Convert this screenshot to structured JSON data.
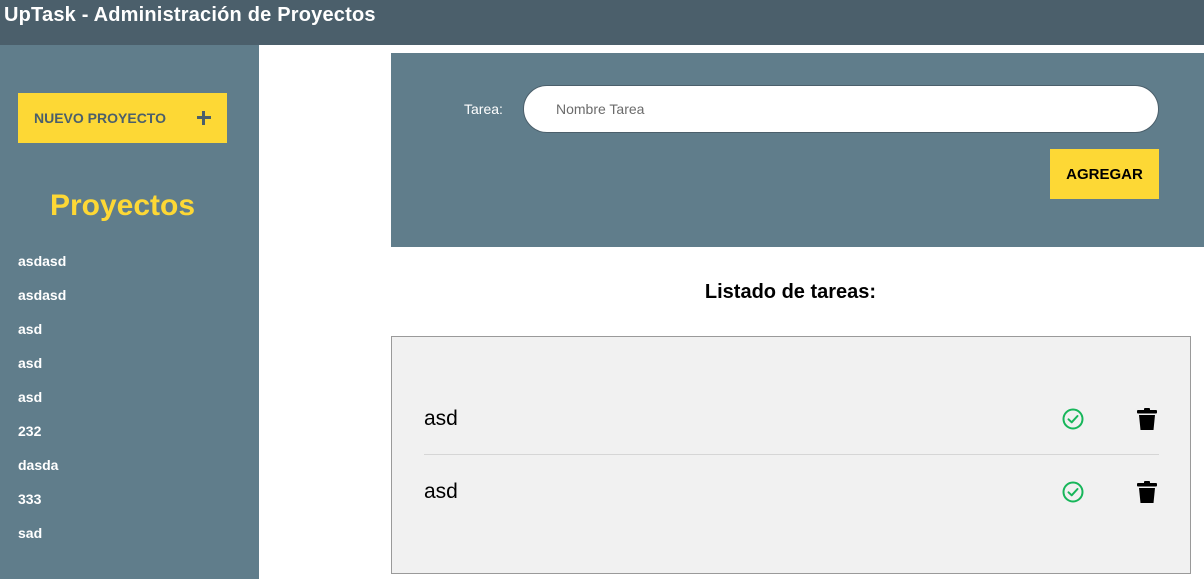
{
  "app": {
    "title": "UpTask - Administración de Proyectos"
  },
  "sidebar": {
    "new_project_label": "NUEVO PROYECTO",
    "heading": "Proyectos",
    "projects": [
      "asdasd",
      "asdasd",
      "asd",
      "asd",
      "asd",
      "232",
      "dasda",
      "333",
      "sad"
    ]
  },
  "form": {
    "task_label": "Tarea:",
    "task_placeholder": "Nombre Tarea",
    "task_value": "",
    "submit_label": "AGREGAR"
  },
  "tasks": {
    "title": "Listado de tareas:",
    "items": [
      {
        "name": "asd"
      },
      {
        "name": "asd"
      }
    ]
  },
  "colors": {
    "topbar": "#4b5f6b",
    "sidebar": "#607d8b",
    "accent": "#fdd835",
    "complete_icon": "#17b65a",
    "delete_icon": "#000000"
  },
  "icons": {
    "new_project": "plus-icon",
    "complete_task": "check-circle-icon",
    "delete_task": "trash-icon"
  }
}
